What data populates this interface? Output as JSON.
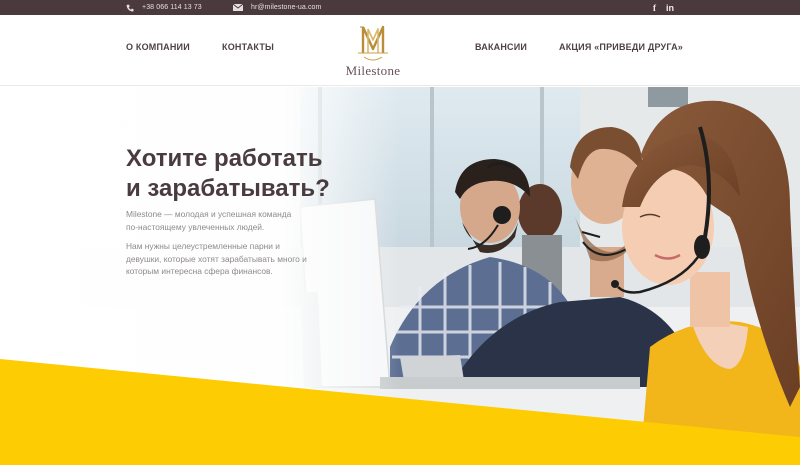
{
  "topbar": {
    "phone": "+38 066 114 13 73",
    "email": "hr@milestone-ua.com",
    "social": [
      {
        "name": "facebook-icon",
        "glyph": "f"
      },
      {
        "name": "linkedin-icon",
        "glyph": "in"
      }
    ]
  },
  "nav": {
    "about": "О КОМПАНИИ",
    "contacts": "КОНТАКТЫ",
    "vacancies": "ВАКАНСИИ",
    "promo": "АКЦИЯ «ПРИВЕДИ ДРУГА»"
  },
  "logo": {
    "text": "Milestone",
    "monogram": "M"
  },
  "hero": {
    "title_line1": "Хотите работать",
    "title_line2": "и зарабатывать?",
    "p1_line1": "Milestone — молодая и успешная команда",
    "p1_line2": "по-настоящему увлеченных людей.",
    "p2_line1": "Нам нужны целеустремленные парни и",
    "p2_line2": "девушки, которые хотят зарабатывать много и",
    "p2_line3": "которым интересна сфера финансов."
  },
  "colors": {
    "topbar_bg": "#4a3a3d",
    "accent_yellow": "#fdcc02",
    "logo_gold": "#c9a24a",
    "text_dark": "#4a3b3f"
  }
}
